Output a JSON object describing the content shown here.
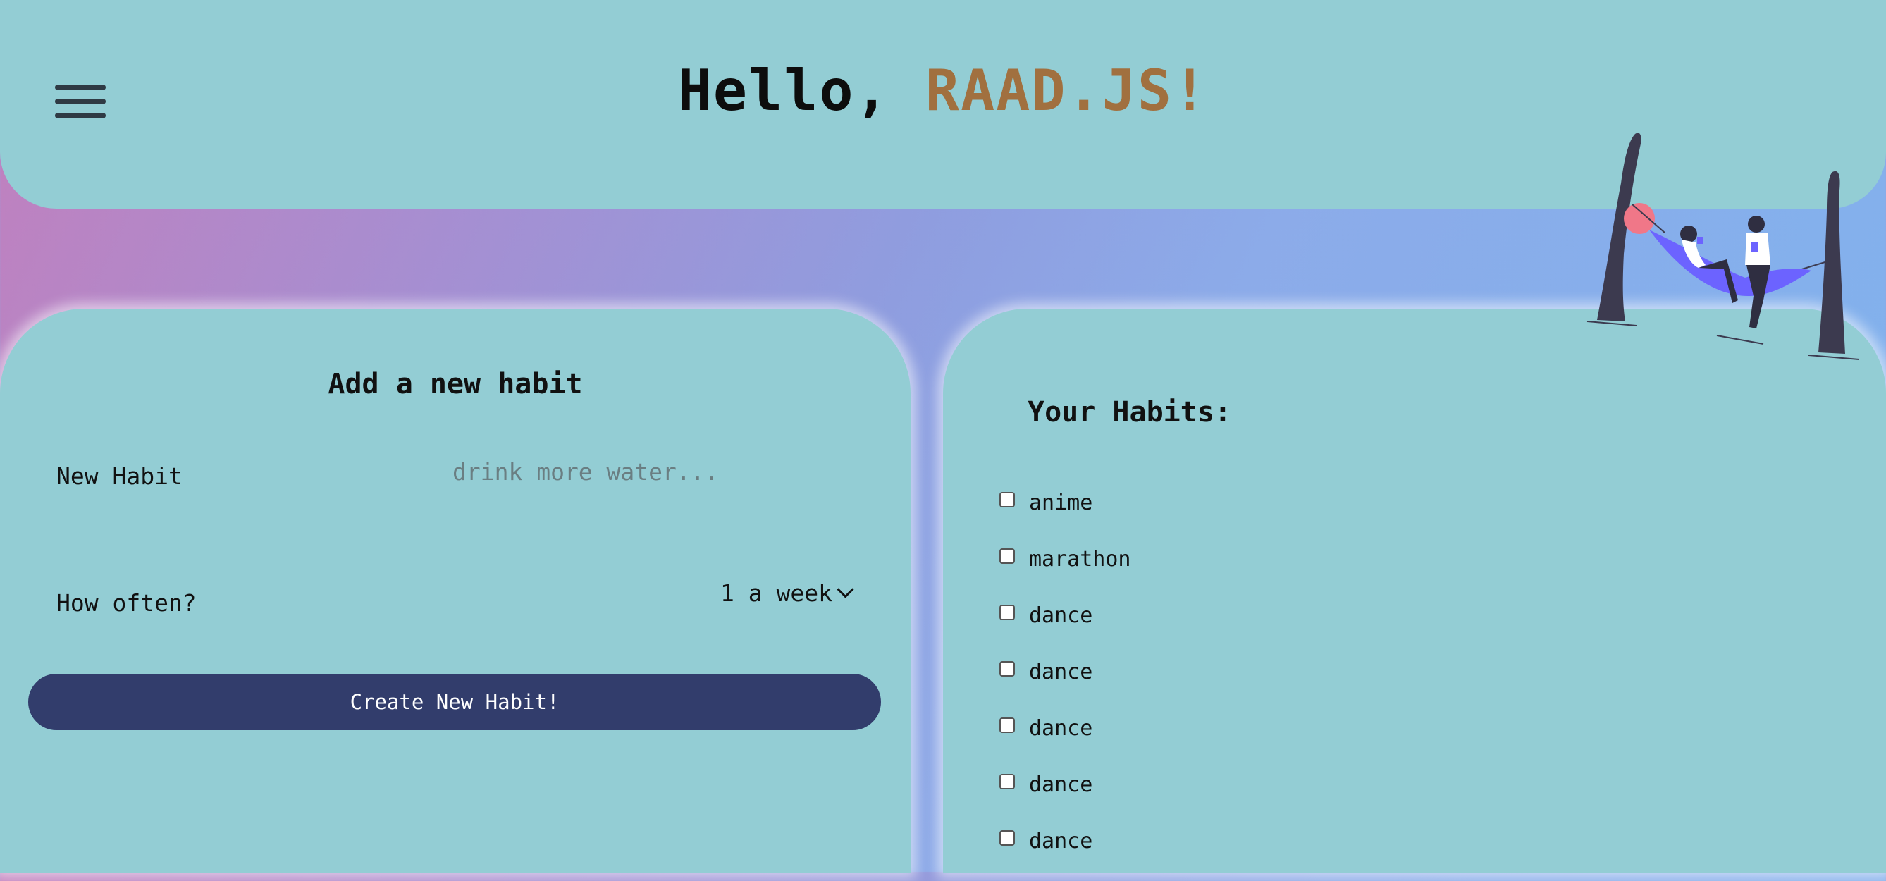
{
  "header": {
    "greeting": "Hello,",
    "user_name": "RAAD.JS!",
    "menu_icon": "hamburger-menu-icon"
  },
  "add_habit": {
    "title": "Add a new habit",
    "habit_label": "New Habit",
    "habit_placeholder": "drink more water...",
    "habit_value": "",
    "frequency_label": "How often?",
    "frequency_value": "1 a week",
    "submit_label": "Create New Habit!"
  },
  "habits": {
    "title": "Your Habits:",
    "items": [
      {
        "label": "anime",
        "checked": false
      },
      {
        "label": "marathon",
        "checked": false
      },
      {
        "label": "dance",
        "checked": false
      },
      {
        "label": "dance",
        "checked": false
      },
      {
        "label": "dance",
        "checked": false
      },
      {
        "label": "dance",
        "checked": false
      },
      {
        "label": "dance",
        "checked": false
      }
    ]
  },
  "colors": {
    "panel": "#93cdd4",
    "accent_name": "#a1703f",
    "button": "#323d6c"
  }
}
